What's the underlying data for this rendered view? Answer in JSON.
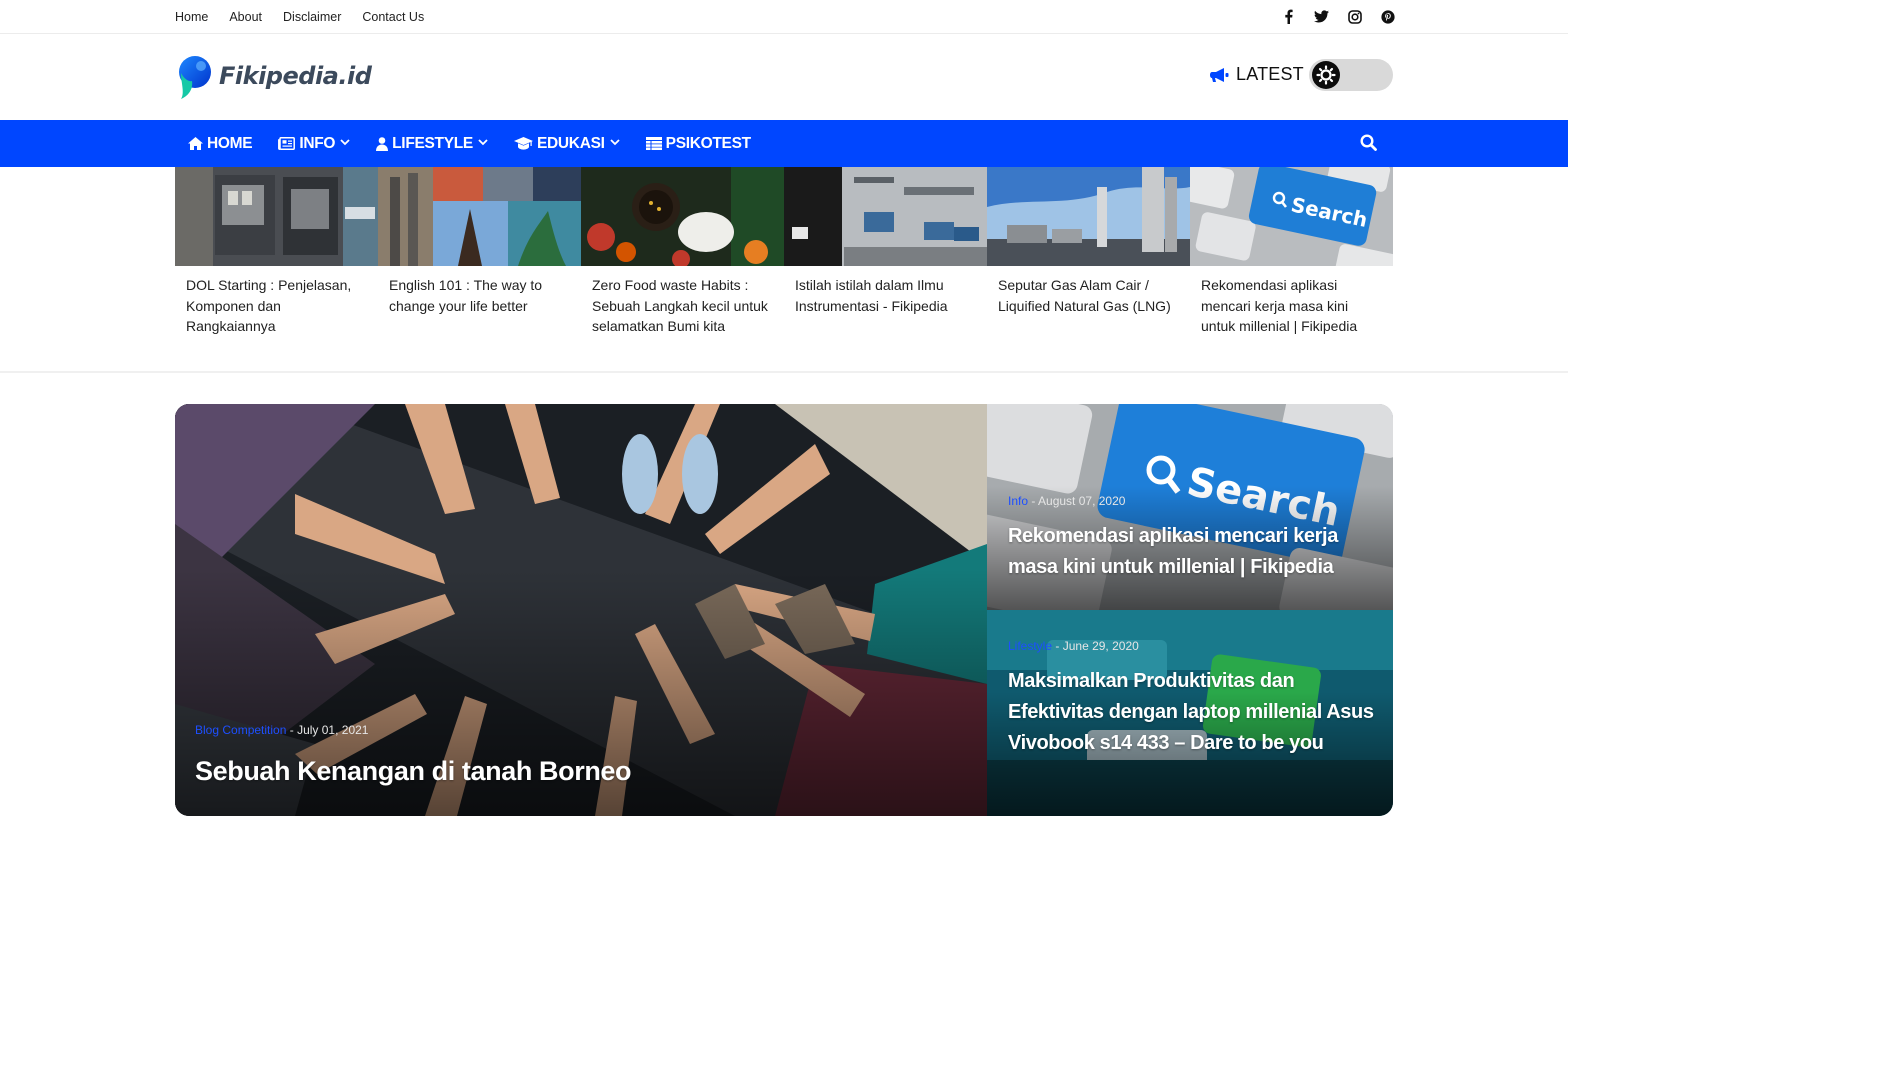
{
  "topbar": {
    "links": [
      "Home",
      "About",
      "Disclaimer",
      "Contact Us"
    ],
    "social_icons": [
      "facebook-icon",
      "twitter-icon",
      "instagram-icon",
      "pinterest-icon"
    ]
  },
  "header": {
    "logo_text": "Fikipedia.id",
    "latest_label": "LATEST"
  },
  "nav": {
    "items": [
      {
        "label": "HOME",
        "icon": "home-icon",
        "dropdown": false
      },
      {
        "label": "INFO",
        "icon": "newspaper-icon",
        "dropdown": true
      },
      {
        "label": "LIFESTYLE",
        "icon": "user-icon",
        "dropdown": true
      },
      {
        "label": "EDUKASI",
        "icon": "graduation-cap-icon",
        "dropdown": true
      },
      {
        "label": "PSIKOTEST",
        "icon": "table-icon",
        "dropdown": false
      }
    ],
    "accent_color": "#0046ff"
  },
  "carousel": [
    {
      "title": "DOL Starting : Penjelasan, Komponen dan Rangkaiannya"
    },
    {
      "title": "English 101 : The way to change your life better"
    },
    {
      "title": "Zero Food waste Habits : Sebuah Langkah kecil untuk selamatkan Bumi kita"
    },
    {
      "title": "Istilah istilah dalam Ilmu Instrumentasi - Fikipedia"
    },
    {
      "title": "Seputar Gas Alam Cair / Liquified Natural Gas (LNG)"
    },
    {
      "title": "Rekomendasi aplikasi mencari kerja masa kini untuk millenial | Fikipedia"
    }
  ],
  "featured": {
    "main": {
      "category": "Blog Competition",
      "date": "July 01, 2021",
      "title": "Sebuah Kenangan di tanah Borneo"
    },
    "side": [
      {
        "category": "Info",
        "date": "August 07, 2020",
        "title": "Rekomendasi aplikasi mencari kerja masa kini untuk millenial | Fikipedia"
      },
      {
        "category": "Lifestyle",
        "date": "June 29, 2020",
        "title": "Maksimalkan Produktivitas dan Efektivitas dengan laptop millenial Asus Vivobook s14 433 – Dare to be you"
      }
    ]
  }
}
